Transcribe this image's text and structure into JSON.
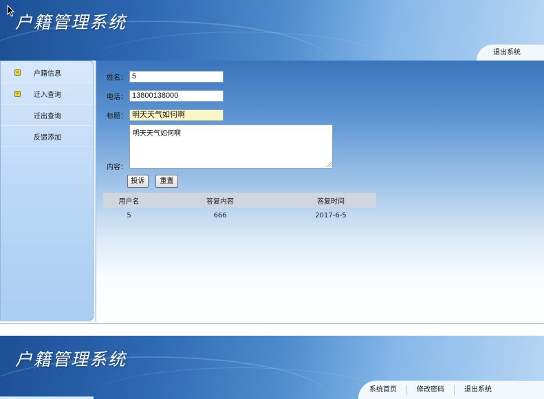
{
  "app_title": "户籍管理系统",
  "top_nav": {
    "logout": "退出系统"
  },
  "sidebar": {
    "items": [
      {
        "label": "户籍信息",
        "icon": "arrow-bullet-icon"
      },
      {
        "label": "迁入查询",
        "icon": "arrow-bullet-icon"
      },
      {
        "label": "迁出查询",
        "icon": ""
      },
      {
        "label": "反馈添加",
        "icon": ""
      }
    ]
  },
  "form": {
    "name_label": "姓名：",
    "name_value": "5",
    "phone_label": "电话：",
    "phone_value": "13800138000",
    "title_label": "标题：",
    "title_value": "明天天气如何啊",
    "content_label": "内容：",
    "content_value": "明天天气如何啊",
    "submit_label": "投诉",
    "reset_label": "重置"
  },
  "table": {
    "headers": [
      "用户名",
      "答复内容",
      "答复时间"
    ],
    "rows": [
      [
        "5",
        "666",
        "2017-6-5"
      ]
    ]
  },
  "second_header": {
    "title": "户籍管理系统",
    "nav": [
      "系统首页",
      "修改密码",
      "退出系统"
    ]
  },
  "colors": {
    "header_dark": "#1c4f95",
    "header_light": "#b7d6f4",
    "highlight_input": "#fbf7c4",
    "table_header": "#cfd6de"
  }
}
